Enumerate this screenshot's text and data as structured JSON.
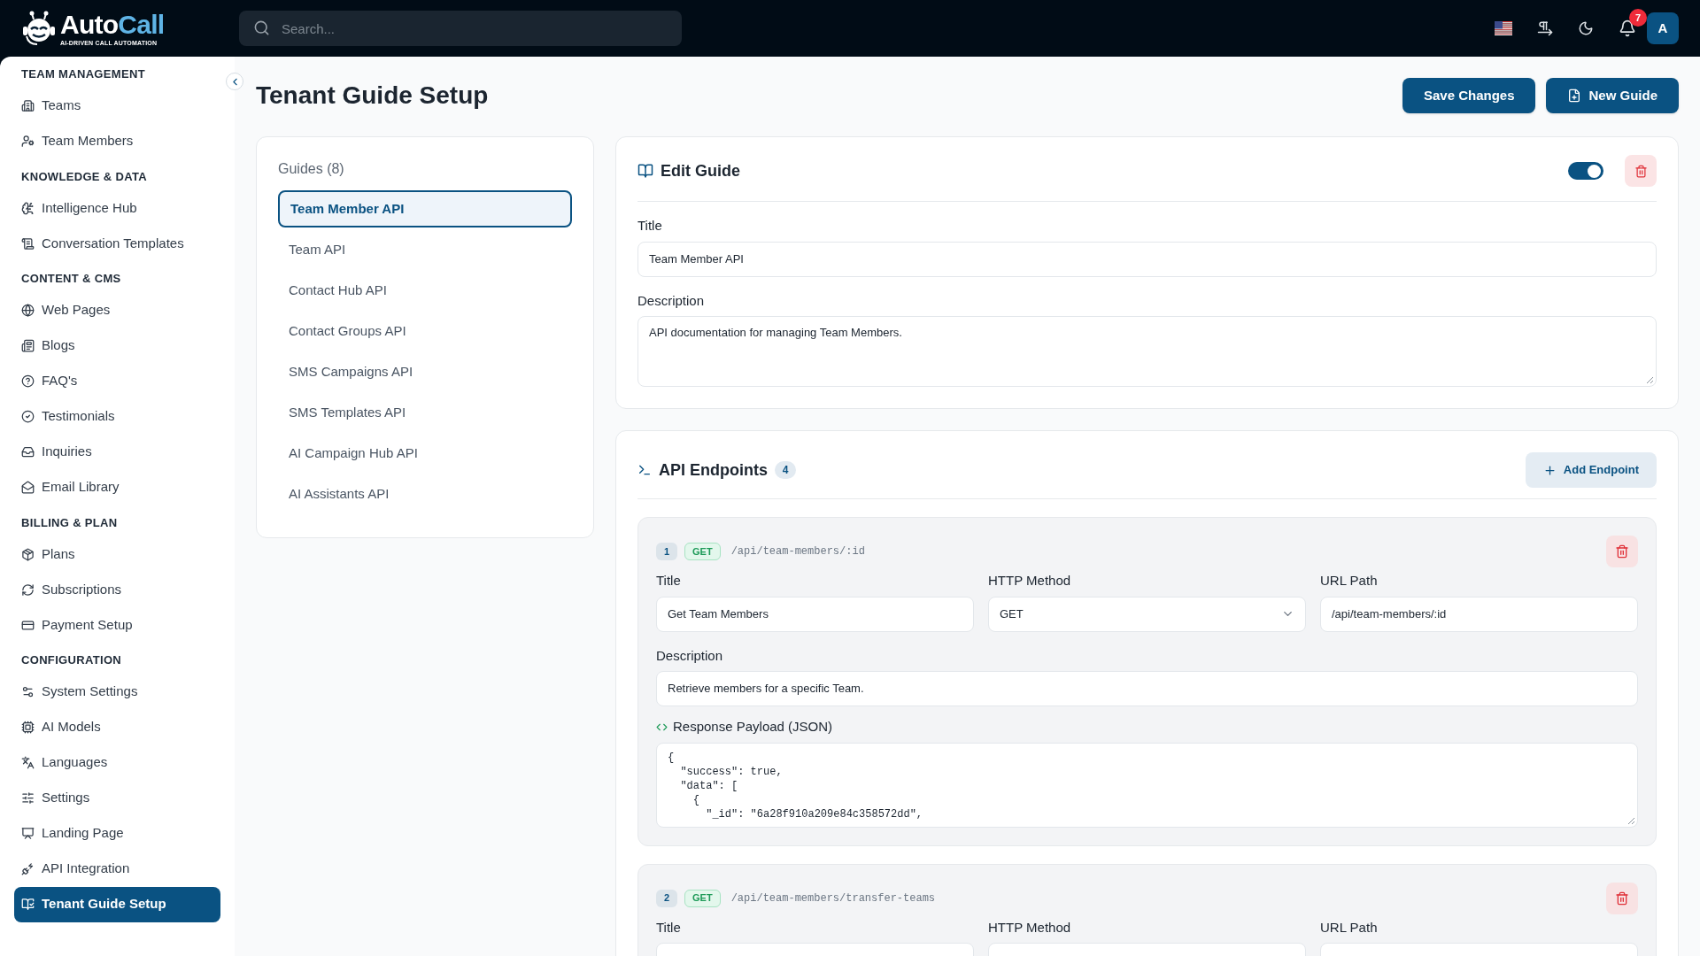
{
  "header": {
    "logo": {
      "name_primary": "Auto",
      "name_accent": "Call",
      "tagline": "AI-DRIVEN CALL AUTOMATION"
    },
    "search": {
      "placeholder": "Search..."
    },
    "notifications": {
      "count": "7"
    },
    "avatar": {
      "initial": "A"
    }
  },
  "sidebar": {
    "sections": [
      {
        "title": "TEAM MANAGEMENT",
        "items": [
          {
            "label": "Teams",
            "selected": false
          },
          {
            "label": "Team Members",
            "selected": false
          }
        ]
      },
      {
        "title": "KNOWLEDGE & DATA",
        "items": [
          {
            "label": "Intelligence Hub",
            "selected": false
          },
          {
            "label": "Conversation Templates",
            "selected": false
          }
        ]
      },
      {
        "title": "CONTENT & CMS",
        "items": [
          {
            "label": "Web Pages",
            "selected": false
          },
          {
            "label": "Blogs",
            "selected": false
          },
          {
            "label": "FAQ's",
            "selected": false
          },
          {
            "label": "Testimonials",
            "selected": false
          },
          {
            "label": "Inquiries",
            "selected": false
          },
          {
            "label": "Email Library",
            "selected": false
          }
        ]
      },
      {
        "title": "BILLING & PLAN",
        "items": [
          {
            "label": "Plans",
            "selected": false
          },
          {
            "label": "Subscriptions",
            "selected": false
          },
          {
            "label": "Payment Setup",
            "selected": false
          }
        ]
      },
      {
        "title": "CONFIGURATION",
        "items": [
          {
            "label": "System Settings",
            "selected": false
          },
          {
            "label": "AI Models",
            "selected": false
          },
          {
            "label": "Languages",
            "selected": false
          },
          {
            "label": "Settings",
            "selected": false
          },
          {
            "label": "Landing Page",
            "selected": false
          },
          {
            "label": "API Integration",
            "selected": false
          },
          {
            "label": "Tenant Guide Setup",
            "selected": true
          }
        ]
      }
    ]
  },
  "page": {
    "title": "Tenant Guide Setup",
    "buttons": [
      {
        "label": "Save Changes",
        "kind": "plain"
      },
      {
        "label": "New Guide",
        "kind": "icon"
      }
    ]
  },
  "guides": {
    "heading": "Guides (8)",
    "items": [
      {
        "label": "Team Member API",
        "selected": true
      },
      {
        "label": "Team API",
        "selected": false
      },
      {
        "label": "Contact Hub API",
        "selected": false
      },
      {
        "label": "Contact Groups API",
        "selected": false
      },
      {
        "label": "SMS Campaigns API",
        "selected": false
      },
      {
        "label": "SMS Templates API",
        "selected": false
      },
      {
        "label": "AI Campaign Hub API",
        "selected": false
      },
      {
        "label": "AI Assistants API",
        "selected": false
      }
    ]
  },
  "edit_guide": {
    "heading": "Edit Guide",
    "enabled": true,
    "title_label": "Title",
    "title_value": "Team Member API",
    "description_label": "Description",
    "description_value": "API documentation for managing Team Members."
  },
  "endpoints": {
    "heading": "API Endpoints",
    "count": "4",
    "add_button": "Add Endpoint",
    "items": [
      {
        "number": "1",
        "method": "GET",
        "path": "/api/team-members/:id",
        "fields": [
          {
            "kind": "text",
            "label": "Title",
            "value": "Get Team Members"
          },
          {
            "kind": "select",
            "label": "HTTP Method",
            "value": "GET"
          },
          {
            "kind": "text",
            "label": "URL Path",
            "value": "/api/team-members/:id"
          }
        ],
        "description_label": "Description",
        "description_value": "Retrieve members for a specific Team.",
        "payload_label": "Response Payload (JSON)",
        "payload": "{\n  \"success\": true,\n  \"data\": [\n    {\n      \"_id\": \"6a28f910a209e84c358572dd\","
      },
      {
        "number": "2",
        "method": "GET",
        "path": "/api/team-members/transfer-teams",
        "fields": [
          {
            "kind": "text",
            "label": "Title"
          },
          {
            "kind": "select",
            "label": "HTTP Method"
          },
          {
            "kind": "text",
            "label": "URL Path"
          }
        ]
      }
    ]
  }
}
